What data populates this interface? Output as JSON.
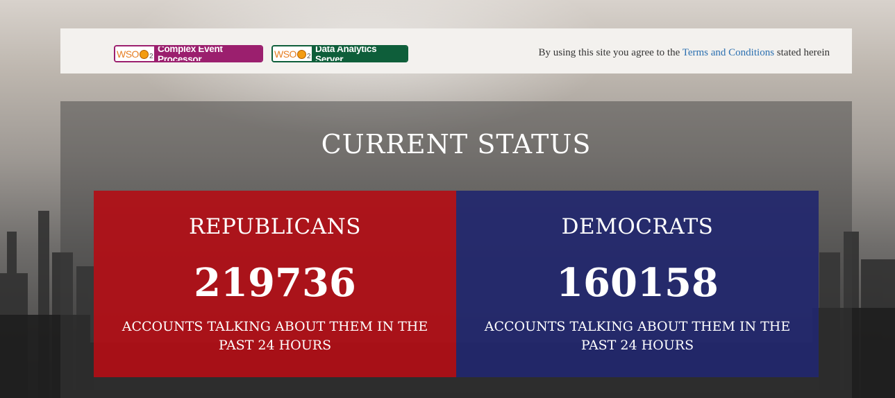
{
  "header": {
    "badges": [
      {
        "logo_text": "WSO",
        "logo_sub": "2",
        "product": "Complex Event Processor",
        "color": "#9b1f6e"
      },
      {
        "logo_text": "WSO",
        "logo_sub": "2",
        "product": "Data Analytics Server",
        "color": "#0e5e3a"
      }
    ],
    "terms": {
      "prefix": "By using this site you agree to the",
      "link": "Terms and Conditions",
      "suffix": "stated herein"
    }
  },
  "status": {
    "title": "CURRENT STATUS",
    "parties": [
      {
        "name": "REPUBLICANS",
        "count": "219736",
        "caption": "ACCOUNTS TALKING ABOUT THEM IN THE PAST 24 HOURS",
        "color": "#b20e16"
      },
      {
        "name": "DEMOCRATS",
        "count": "160158",
        "caption": "ACCOUNTS TALKING ABOUT THEM IN THE PAST 24 HOURS",
        "color": "#22276e"
      }
    ]
  }
}
